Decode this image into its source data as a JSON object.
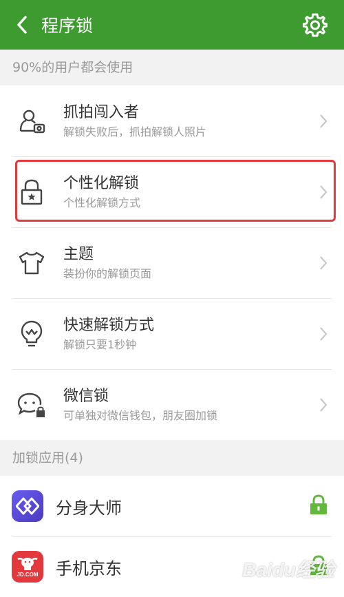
{
  "appbar": {
    "title": "程序锁",
    "back_icon": "chevron-left-icon",
    "settings_icon": "gear-icon",
    "color": "#3d9b2f"
  },
  "section_features": {
    "header": "90%的用户都会使用",
    "items": [
      {
        "icon": "intruder-photo-icon",
        "title": "抓拍闯入者",
        "subtitle": "解锁失败后，抓拍解锁人照片"
      },
      {
        "icon": "personalized-lock-icon",
        "title": "个性化解锁",
        "subtitle": "个性化解锁方式",
        "highlighted": true
      },
      {
        "icon": "tshirt-icon",
        "title": "主题",
        "subtitle": "装扮你的解锁页面"
      },
      {
        "icon": "lightbulb-icon",
        "title": "快速解锁方式",
        "subtitle": "解锁只要1秒钟"
      },
      {
        "icon": "wechat-lock-icon",
        "title": "微信锁",
        "subtitle": "可单独对微信钱包，朋友圈加锁"
      }
    ]
  },
  "section_locked_apps": {
    "header": "加锁应用(4)",
    "apps": [
      {
        "icon": "fenshen-dashi-app-icon",
        "name": "分身大师",
        "locked": true,
        "icon_color": "#5b4bd6"
      },
      {
        "icon": "jd-app-icon",
        "name": "手机京东",
        "locked": true,
        "icon_color": "#e4393c",
        "icon_text": "JD.COM"
      }
    ]
  },
  "colors": {
    "highlight_border": "#e0393e",
    "lock_green": "#62b83b"
  },
  "watermark": "Baidu经验"
}
